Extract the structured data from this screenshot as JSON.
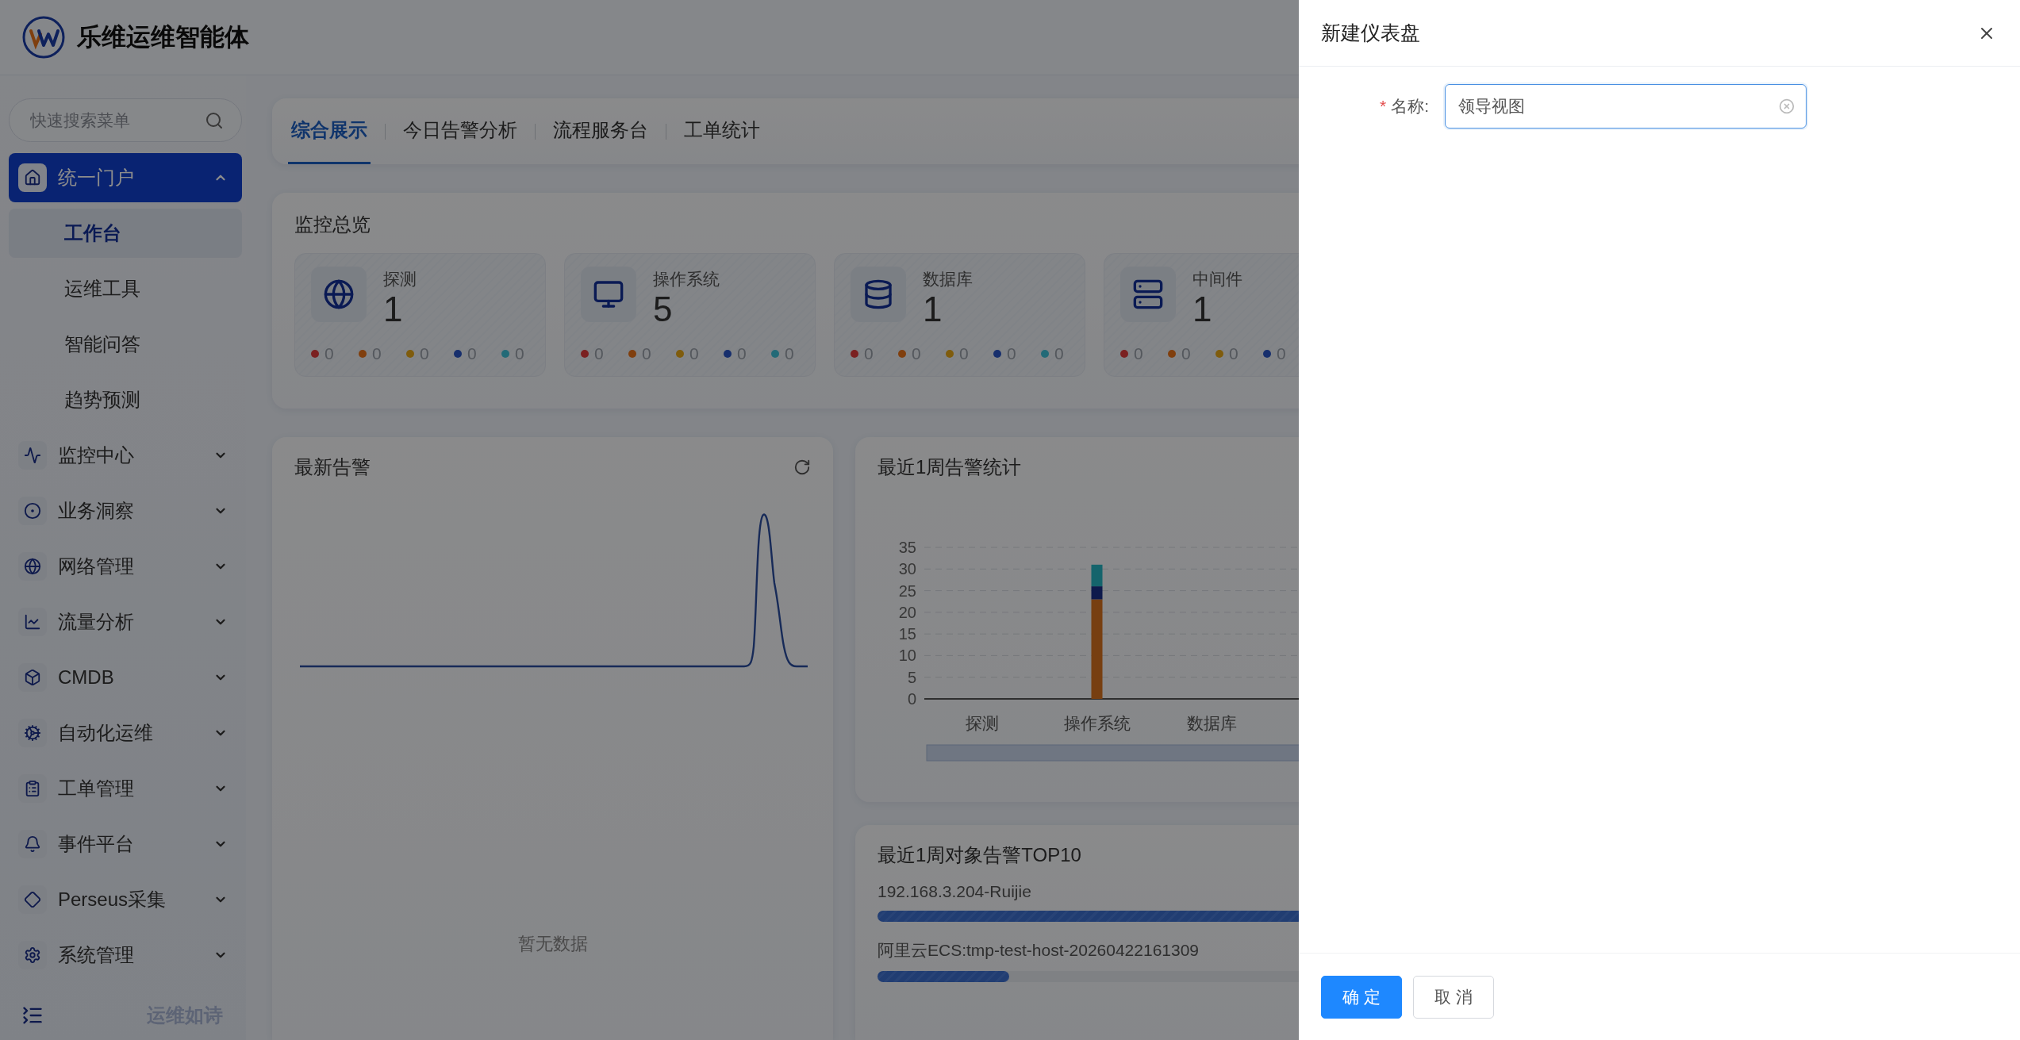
{
  "app": {
    "title": "乐维运维智能体"
  },
  "sidebar": {
    "search": {
      "placeholder": "快速搜索菜单"
    },
    "menu": [
      {
        "label": "统一门户",
        "selected": true,
        "expanded": true,
        "children": [
          {
            "label": "工作台",
            "selected": true
          },
          {
            "label": "运维工具",
            "selected": false
          },
          {
            "label": "智能问答",
            "selected": false
          },
          {
            "label": "趋势预测",
            "selected": false
          }
        ]
      },
      {
        "label": "监控中心",
        "selected": false,
        "expanded": false
      },
      {
        "label": "业务洞察",
        "selected": false,
        "expanded": false
      },
      {
        "label": "网络管理",
        "selected": false,
        "expanded": false
      },
      {
        "label": "流量分析",
        "selected": false,
        "expanded": false
      },
      {
        "label": "CMDB",
        "selected": false,
        "expanded": false
      },
      {
        "label": "自动化运维",
        "selected": false,
        "expanded": false
      },
      {
        "label": "工单管理",
        "selected": false,
        "expanded": false
      },
      {
        "label": "事件平台",
        "selected": false,
        "expanded": false
      },
      {
        "label": "Perseus采集",
        "selected": false,
        "expanded": false
      },
      {
        "label": "系统管理",
        "selected": false,
        "expanded": false
      }
    ],
    "footer": {
      "slogan": "运维如诗"
    }
  },
  "tabs": [
    {
      "label": "综合展示",
      "selected": true
    },
    {
      "label": "今日告警分析",
      "selected": false
    },
    {
      "label": "流程服务台",
      "selected": false
    },
    {
      "label": "工单统计",
      "selected": false
    }
  ],
  "overview": {
    "title": "监控总览",
    "cards": [
      {
        "label": "探测",
        "count": "1",
        "dots": [
          {
            "color": "#7b2121",
            "value": "0"
          },
          {
            "color": "#803f0e",
            "value": "0"
          },
          {
            "color": "#7f5c0d",
            "value": "0"
          },
          {
            "color": "#172f6d",
            "value": "0"
          },
          {
            "color": "#236a77",
            "value": "0"
          }
        ]
      },
      {
        "label": "操作系统",
        "count": "5",
        "dots": [
          {
            "color": "#7b2121",
            "value": "0"
          },
          {
            "color": "#803f0e",
            "value": "0"
          },
          {
            "color": "#7f5c0d",
            "value": "0"
          },
          {
            "color": "#172f6d",
            "value": "0"
          },
          {
            "color": "#236a77",
            "value": "0"
          }
        ]
      },
      {
        "label": "数据库",
        "count": "1",
        "dots": [
          {
            "color": "#7b2121",
            "value": "0"
          },
          {
            "color": "#803f0e",
            "value": "0"
          },
          {
            "color": "#7f5c0d",
            "value": "0"
          },
          {
            "color": "#172f6d",
            "value": "0"
          },
          {
            "color": "#236a77",
            "value": "0"
          }
        ]
      },
      {
        "label": "中间件",
        "count": "1",
        "dots": [
          {
            "color": "#7b2121",
            "value": "0"
          },
          {
            "color": "#803f0e",
            "value": "0"
          },
          {
            "color": "#7f5c0d",
            "value": "0"
          },
          {
            "color": "#172f6d",
            "value": "0"
          }
        ]
      }
    ]
  },
  "latest_alerts": {
    "title": "最新告警",
    "empty_text": "暂无数据"
  },
  "weekly_stats": {
    "title": "最近1周告警统计",
    "chart_data": {
      "type": "bar",
      "stacked": true,
      "categories": [
        "探测",
        "操作系统",
        "数据库"
      ],
      "series": [
        {
          "color": "#773f11",
          "values": [
            0,
            23,
            0
          ]
        },
        {
          "color": "#0e1a4c",
          "values": [
            0,
            3,
            0
          ]
        },
        {
          "color": "#15646c",
          "values": [
            0,
            5,
            0
          ]
        }
      ],
      "ylim": [
        0,
        35
      ],
      "yticks": [
        0,
        5,
        10,
        15,
        20,
        25,
        30,
        35
      ],
      "grid": true
    }
  },
  "top10": {
    "title": "最近1周对象告警TOP10",
    "rows": [
      {
        "name": "192.168.3.204-Ruijie",
        "level": 1
      },
      {
        "name": "阿里云ECS:tmp-test-host-20260422161309",
        "level": 0.12
      }
    ]
  },
  "drawer": {
    "title": "新建仪表盘",
    "fields": [
      {
        "label": "名称:",
        "required_mark": "*",
        "value": "领导视图"
      }
    ],
    "buttons": [
      {
        "label": "确 定",
        "kind": "primary"
      },
      {
        "label": "取 消",
        "kind": "default"
      }
    ]
  }
}
